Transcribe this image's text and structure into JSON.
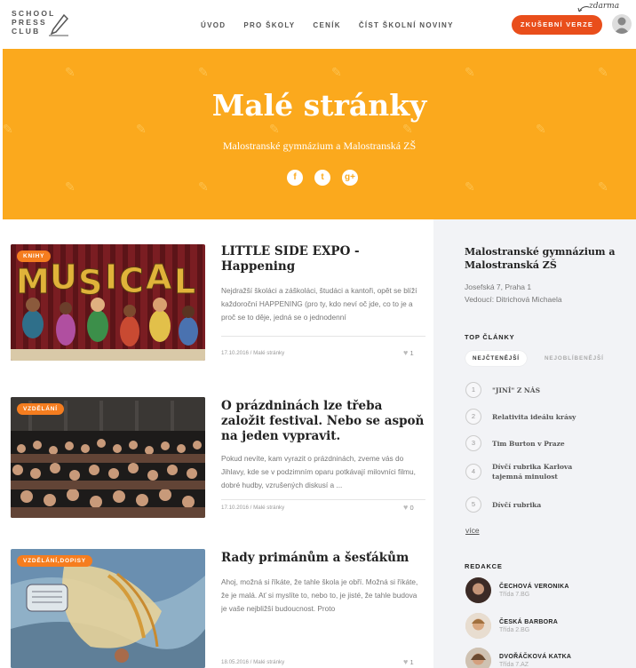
{
  "header": {
    "logo_lines": [
      "SCHOOL",
      "PRESS",
      "CLUB"
    ],
    "nav": [
      "ÚVOD",
      "PRO ŠKOLY",
      "CENÍK",
      "ČÍST ŠKOLNÍ NOVINY"
    ],
    "cta_label": "ZKUŠEBNÍ VERZE",
    "cta_note": "zdarma",
    "accent": "#e94e1b"
  },
  "hero": {
    "title": "Malé stránky",
    "subtitle": "Malostranské gymnázium a Malostranská ZŠ",
    "social": [
      "f",
      "t",
      "g+"
    ],
    "background": "#fba91d"
  },
  "articles": [
    {
      "badge": "KNIHY",
      "title": "LITTLE SIDE EXPO - Happening",
      "excerpt": "Nejdražší školáci a záškoláci, študáci a kantoři,   opět se blíží každoroční HAPPENING (pro ty, kdo neví oč jde, co to je a proč se to děje, jedná se o jednodenní",
      "meta": "17.10.2016 / Malé stránky",
      "likes": "1",
      "image": "musical-banner"
    },
    {
      "badge": "VZDĚLÁNÍ",
      "title": "O prázdninách lze třeba založit festival. Nebo se aspoň na jeden vypravit.",
      "excerpt": "Pokud nevíte, kam vyrazit o prázdninách, zveme vás do Jihlavy, kde se v podzimním oparu potkávají milovníci filmu, dobré hudby, vzrušených diskusí a ...",
      "meta": "17.10.2016 / Malé stránky",
      "likes": "0",
      "image": "festival-crowd"
    },
    {
      "badge": "VZDĚLÁNÍ,DOPISY",
      "title": "Rady primánům a šesťákům",
      "excerpt": "Ahoj, možná si říkáte, že tahle škola je obří. Možná si říkáte, že je malá. Ať si myslíte to, nebo to, je jisté, že tahle budova je vaše nejbližší budoucnost. Proto",
      "meta": "18.05.2016 / Malé stránky",
      "likes": "1",
      "image": "painted-drawing"
    }
  ],
  "sidebar": {
    "school_name": "Malostranské gymnázium a Malostranská ZŠ",
    "address": "Josefská 7, Praha 1",
    "head": "Vedoucí: Ditrichová Michaela",
    "top_heading": "TOP ČLÁNKY",
    "tabs": [
      "NEJČTENĚJŠÍ",
      "NEJOBLÍBENĚJŠÍ"
    ],
    "top_articles": [
      {
        "num": "1",
        "title": "\"JINÍ\" Z NÁS"
      },
      {
        "num": "2",
        "title": "Relativita ideálu krásy"
      },
      {
        "num": "3",
        "title": "Tim Burton v Praze"
      },
      {
        "num": "4",
        "title": "Dívčí rubrika Karlova tajemná minulost"
      },
      {
        "num": "5",
        "title": "Dívčí rubrika"
      }
    ],
    "more": "více",
    "editors_heading": "REDAKCE",
    "editors": [
      {
        "name": "ČECHOVÁ VERONIKA",
        "class": "Třída 7.BG"
      },
      {
        "name": "ČESKÁ BARBORA",
        "class": "Třída 2.BG"
      },
      {
        "name": "DVOŘÁČKOVÁ KATKA",
        "class": "Třída 7.AZ"
      }
    ]
  }
}
